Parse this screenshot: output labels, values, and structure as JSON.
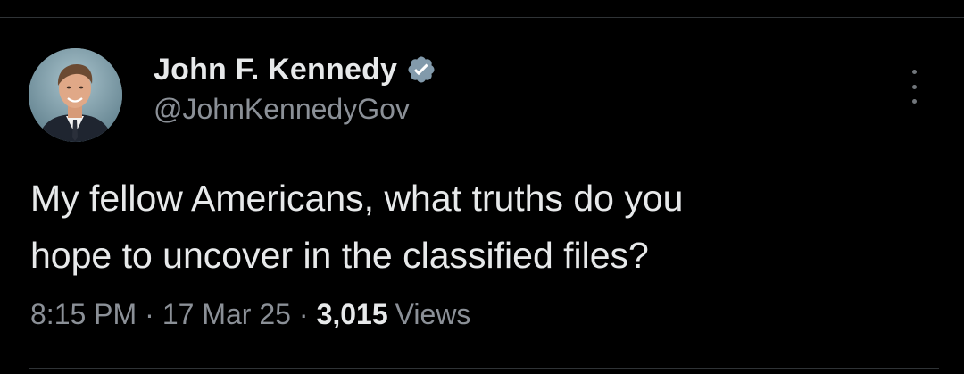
{
  "tweet": {
    "author": {
      "display_name": "John F. Kennedy",
      "handle": "@JohnKennedyGov",
      "verified_icon": "verified-badge-icon",
      "avatar": "profile-photo"
    },
    "text_lines": [
      "My fellow Americans, what truths do you",
      "hope to uncover in the classified files?"
    ],
    "meta": {
      "time": "8:15 PM",
      "separator": "·",
      "date": "17 Mar 25",
      "views_count": "3,015",
      "views_label": "Views"
    },
    "more_icon": "more-options-icon"
  },
  "colors": {
    "background": "#000000",
    "primary_text": "#e7e9ea",
    "secondary_text": "#8b9097",
    "verified_badge": "#829aab",
    "divider": "#2f3336"
  }
}
